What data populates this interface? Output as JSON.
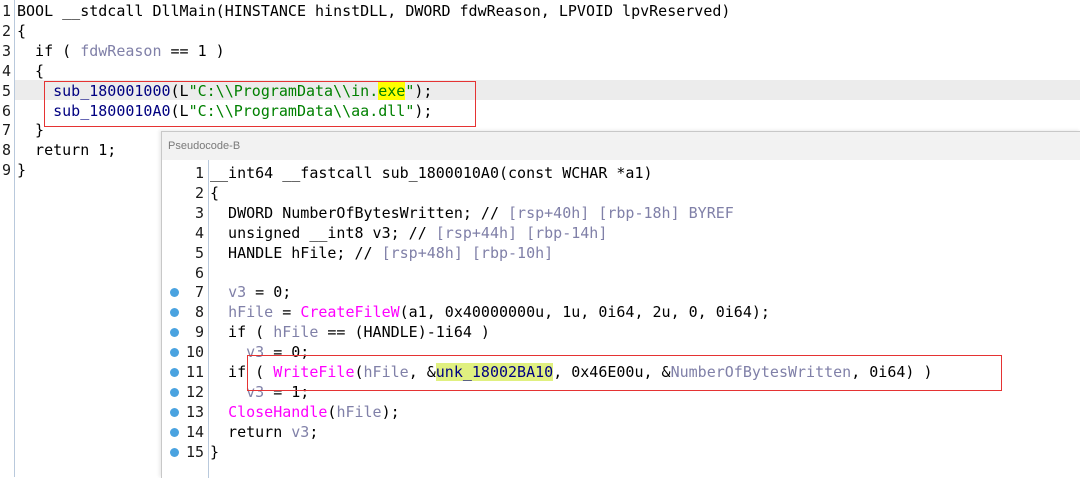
{
  "main_pane": {
    "lines": [
      {
        "num": "1",
        "parts": [
          {
            "t": "BOOL __stdcall DllMain(HINSTANCE hinstDLL, DWORD fdwReason, LPVOID lpvReserved)",
            "c": "kw"
          }
        ]
      },
      {
        "num": "2",
        "parts": [
          {
            "t": "{",
            "c": "kw"
          }
        ]
      },
      {
        "num": "3",
        "parts": [
          {
            "t": "  if ( ",
            "c": "kw"
          },
          {
            "t": "fdwReason",
            "c": "ident-gray"
          },
          {
            "t": " == 1 )",
            "c": "kw"
          }
        ]
      },
      {
        "num": "4",
        "parts": [
          {
            "t": "  {",
            "c": "kw"
          }
        ]
      },
      {
        "num": "5",
        "parts": [
          {
            "t": "    sub_180001000",
            "c": "navy"
          },
          {
            "t": "(L",
            "c": "kw"
          },
          {
            "t": "\"C:\\\\ProgramData\\\\in.",
            "c": "str"
          },
          {
            "t": "exe",
            "c": "str yellowbg"
          },
          {
            "t": "\"",
            "c": "str"
          },
          {
            "t": ");",
            "c": "kw"
          }
        ]
      },
      {
        "num": "6",
        "parts": [
          {
            "t": "    sub_1800010A0",
            "c": "navy"
          },
          {
            "t": "(L",
            "c": "kw"
          },
          {
            "t": "\"C:\\\\ProgramData\\\\aa.dll\"",
            "c": "str"
          },
          {
            "t": ");",
            "c": "kw"
          }
        ]
      },
      {
        "num": "7",
        "parts": [
          {
            "t": "  }",
            "c": "kw"
          }
        ]
      },
      {
        "num": "8",
        "parts": [
          {
            "t": "  return 1;",
            "c": "kw"
          }
        ]
      },
      {
        "num": "9",
        "parts": [
          {
            "t": "}",
            "c": "kw"
          }
        ]
      }
    ]
  },
  "overlay": {
    "title": "Pseudocode-B",
    "lines": [
      {
        "num": "1",
        "dot": false,
        "parts": [
          {
            "t": "__int64 __fastcall sub_1800010A0(const WCHAR *a1)",
            "c": "kw"
          }
        ]
      },
      {
        "num": "2",
        "dot": false,
        "parts": [
          {
            "t": "{",
            "c": "kw"
          }
        ]
      },
      {
        "num": "3",
        "dot": false,
        "parts": [
          {
            "t": "  DWORD NumberOfBytesWritten; // ",
            "c": "kw"
          },
          {
            "t": "[rsp+40h] [rbp-18h] BYREF",
            "c": "ident-gray"
          }
        ]
      },
      {
        "num": "4",
        "dot": false,
        "parts": [
          {
            "t": "  unsigned __int8 v3; // ",
            "c": "kw"
          },
          {
            "t": "[rsp+44h] [rbp-14h]",
            "c": "ident-gray"
          }
        ]
      },
      {
        "num": "5",
        "dot": false,
        "parts": [
          {
            "t": "  HANDLE hFile; // ",
            "c": "kw"
          },
          {
            "t": "[rsp+48h] [rbp-10h]",
            "c": "ident-gray"
          }
        ]
      },
      {
        "num": "6",
        "dot": false,
        "parts": [
          {
            "t": "",
            "c": "kw"
          }
        ]
      },
      {
        "num": "7",
        "dot": true,
        "parts": [
          {
            "t": "  ",
            "c": "kw"
          },
          {
            "t": "v3",
            "c": "ident-gray"
          },
          {
            "t": " = 0;",
            "c": "kw"
          }
        ]
      },
      {
        "num": "8",
        "dot": true,
        "parts": [
          {
            "t": "  ",
            "c": "kw"
          },
          {
            "t": "hFile",
            "c": "ident-gray"
          },
          {
            "t": " = ",
            "c": "kw"
          },
          {
            "t": "CreateFileW",
            "c": "func-pink"
          },
          {
            "t": "(a1, 0x40000000u, 1u, 0i64, 2u, 0, 0i64);",
            "c": "kw"
          }
        ]
      },
      {
        "num": "9",
        "dot": true,
        "parts": [
          {
            "t": "  if ( ",
            "c": "kw"
          },
          {
            "t": "hFile",
            "c": "ident-gray"
          },
          {
            "t": " == (HANDLE)-1i64 )",
            "c": "kw"
          }
        ]
      },
      {
        "num": "10",
        "dot": true,
        "parts": [
          {
            "t": "    ",
            "c": "kw"
          },
          {
            "t": "v3",
            "c": "ident-gray"
          },
          {
            "t": " = 0;",
            "c": "kw"
          }
        ]
      },
      {
        "num": "11",
        "dot": true,
        "parts": [
          {
            "t": "  if ( ",
            "c": "kw"
          },
          {
            "t": "WriteFile",
            "c": "func-pink"
          },
          {
            "t": "(",
            "c": "kw"
          },
          {
            "t": "hFile",
            "c": "ident-gray"
          },
          {
            "t": ", &",
            "c": "kw"
          },
          {
            "t": "unk_18002BA10",
            "c": "navy greenbg"
          },
          {
            "t": ", 0x46E00u, &",
            "c": "kw"
          },
          {
            "t": "NumberOfBytesWritten",
            "c": "ident-gray"
          },
          {
            "t": ", 0i64) )",
            "c": "kw"
          }
        ]
      },
      {
        "num": "12",
        "dot": true,
        "parts": [
          {
            "t": "    ",
            "c": "kw"
          },
          {
            "t": "v3",
            "c": "ident-gray"
          },
          {
            "t": " = 1;",
            "c": "kw"
          }
        ]
      },
      {
        "num": "13",
        "dot": true,
        "parts": [
          {
            "t": "  ",
            "c": "kw"
          },
          {
            "t": "CloseHandle",
            "c": "func-pink"
          },
          {
            "t": "(",
            "c": "kw"
          },
          {
            "t": "hFile",
            "c": "ident-gray"
          },
          {
            "t": ");",
            "c": "kw"
          }
        ]
      },
      {
        "num": "14",
        "dot": true,
        "parts": [
          {
            "t": "  return ",
            "c": "kw"
          },
          {
            "t": "v3",
            "c": "ident-gray"
          },
          {
            "t": ";",
            "c": "kw"
          }
        ]
      },
      {
        "num": "15",
        "dot": true,
        "parts": [
          {
            "t": "}",
            "c": "kw"
          }
        ]
      }
    ]
  },
  "colors": {
    "highlight_box": "#e53333",
    "breakpoint_dot": "#4aa3e0",
    "current_line_bg": "#ececec"
  }
}
